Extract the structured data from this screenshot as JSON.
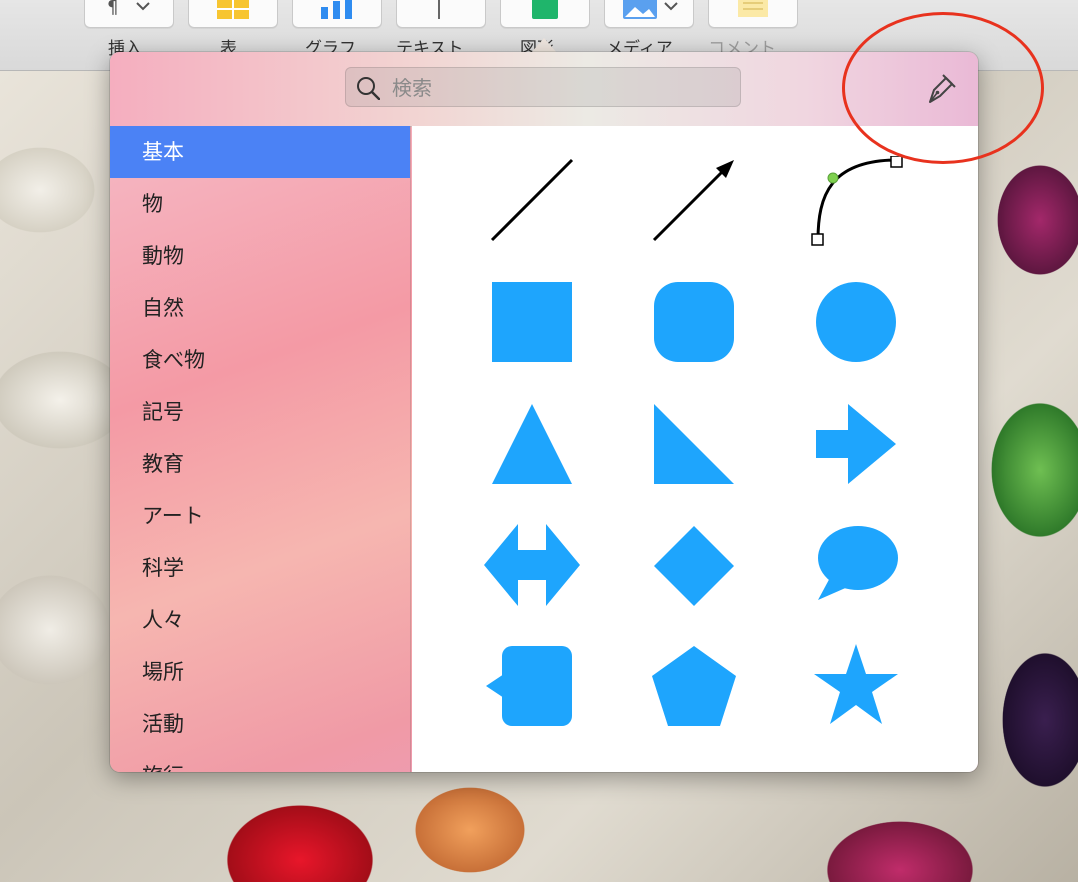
{
  "toolbar": {
    "buttons": [
      {
        "label": "挿入"
      },
      {
        "label": "表"
      },
      {
        "label": "グラフ"
      },
      {
        "label": "テキスト"
      },
      {
        "label": "図形"
      },
      {
        "label": "メディア"
      },
      {
        "label": "コメント"
      }
    ]
  },
  "popover": {
    "search": {
      "placeholder": "検索",
      "value": ""
    },
    "categories": [
      {
        "label": "基本",
        "selected": true
      },
      {
        "label": "物"
      },
      {
        "label": "動物"
      },
      {
        "label": "自然"
      },
      {
        "label": "食べ物"
      },
      {
        "label": "記号"
      },
      {
        "label": "教育"
      },
      {
        "label": "アート"
      },
      {
        "label": "科学"
      },
      {
        "label": "人々"
      },
      {
        "label": "場所"
      },
      {
        "label": "活動"
      },
      {
        "label": "旅行"
      }
    ],
    "shapes": [
      "line",
      "arrow-line",
      "curve",
      "square",
      "rounded-square",
      "circle",
      "triangle",
      "right-triangle",
      "arrow",
      "double-arrow",
      "diamond",
      "speech-bubble",
      "callout-square",
      "pentagon",
      "star"
    ]
  },
  "colors": {
    "shape_fill": "#1ea5fd",
    "selection": "#4b82f5",
    "annotation_circle": "#e8321e"
  }
}
